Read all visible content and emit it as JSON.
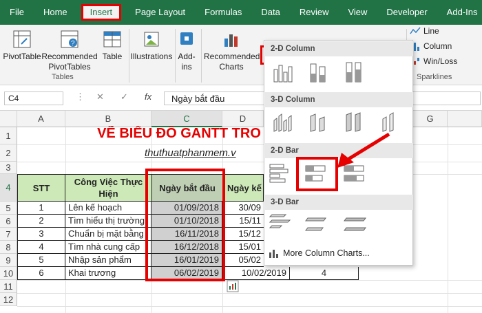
{
  "tabs": [
    "File",
    "Home",
    "Insert",
    "Page Layout",
    "Formulas",
    "Data",
    "Review",
    "View",
    "Developer",
    "Add-Ins"
  ],
  "active_tab": "Insert",
  "help_glyph": "💡",
  "ribbon": {
    "pivottable": "PivotTable",
    "recommended_pivot": "Recommended PivotTables",
    "table": "Table",
    "illustrations": "Illustrations",
    "addins": "Add-ins",
    "recommended_charts": "Recommended Charts",
    "tables_group": "Tables",
    "spark_line": "Line",
    "spark_column": "Column",
    "spark_winloss": "Win/Loss",
    "sparklines_group": "Sparklines"
  },
  "formula_bar": {
    "name_box": "C4",
    "fx": "fx",
    "value": "Ngày bắt đầu"
  },
  "columns": [
    "A",
    "B",
    "C",
    "D",
    "G"
  ],
  "rows": [
    "1",
    "2",
    "3",
    "4",
    "5",
    "6",
    "7",
    "8",
    "9",
    "10",
    "11",
    "12"
  ],
  "sheet": {
    "title": "VẼ BIỂU ĐỒ GANTT TRO",
    "subtitle": "thuthuatphanmem.v",
    "headers": {
      "stt": "STT",
      "cong_viec": "Công Việc Thực Hiện",
      "start": "Ngày bắt đầu",
      "end": "Ngày kế"
    },
    "rows": [
      {
        "stt": "1",
        "task": "Lên kế hoạch",
        "start": "01/09/2018",
        "end": "30/09"
      },
      {
        "stt": "2",
        "task": "Tìm hiểu thị trường",
        "start": "01/10/2018",
        "end": "15/11"
      },
      {
        "stt": "3",
        "task": "Chuẩn bị mặt bằng",
        "start": "16/11/2018",
        "end": "15/12"
      },
      {
        "stt": "4",
        "task": "Tìm nhà cung cấp",
        "start": "16/12/2018",
        "end": "15/01"
      },
      {
        "stt": "5",
        "task": "Nhập sản phẩm",
        "start": "16/01/2019",
        "end": "05/02"
      },
      {
        "stt": "6",
        "task": "Khai trương",
        "start": "06/02/2019",
        "end": "10/02/2019",
        "extra": "4"
      }
    ]
  },
  "dropdown": {
    "sections": [
      "2-D Column",
      "3-D Column",
      "2-D Bar",
      "3-D Bar"
    ],
    "more": "More Column Charts..."
  },
  "colors": {
    "excel_green": "#217346",
    "highlight_red": "#e60000",
    "header_green": "#cde9b8",
    "selection_gray": "#d0d0d0"
  }
}
